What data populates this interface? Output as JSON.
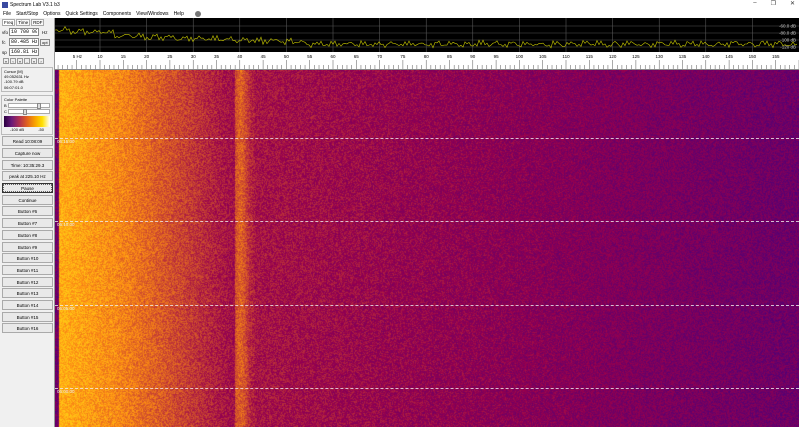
{
  "window": {
    "title": "Spectrum Lab V3.1 b3",
    "minimize": "–",
    "restore": "❐",
    "close": "✕"
  },
  "menu": [
    "File",
    "Start/Stop",
    "Options",
    "Quick Settings",
    "Components",
    "View/Windows",
    "Help"
  ],
  "tabs": [
    "Freq",
    "Time",
    "RDF"
  ],
  "freq": {
    "vfo_label": "vfo",
    "vfo": "10 700 000",
    "vfo_unit": "Hz",
    "fc_label": "fc",
    "fc": "80.485 Hz",
    "opt": "opt",
    "sp_label": "sp",
    "sp": "160.81 Hz"
  },
  "nav_arrows": [
    "«",
    "‹",
    "«",
    "-",
    "»",
    "›"
  ],
  "cursor": {
    "title": "Cursor [M]",
    "freq": "49.052631 Hz",
    "level": "-100.79 dB",
    "time": "06:07:01.0"
  },
  "palette": {
    "title": "Color Palette",
    "b": "B",
    "c": "C",
    "min": "-100 dB",
    "max": "-50"
  },
  "buttons": [
    "Read 10:08:09",
    "Capture now",
    "Time:  10:35:29.3",
    "peak at 225.10 Hz",
    "Pause",
    "Continue",
    "Button #6",
    "Button #7",
    "Button #8",
    "Button #9",
    "Button #10",
    "Button #11",
    "Button #12",
    "Button #13",
    "Button #14",
    "Button #15",
    "Button #16"
  ],
  "spectrum": {
    "db_labels": [
      "-60.0 dB",
      "-80.0 dB",
      "-100 dB",
      "-120 dB"
    ],
    "trace_color": "#c8c800"
  },
  "axis": {
    "first_label": "5  Hz",
    "ticks": [
      10,
      15,
      20,
      25,
      30,
      35,
      40,
      45,
      50,
      55,
      60,
      65,
      70,
      75,
      80,
      85,
      90,
      95,
      100,
      105,
      110,
      115,
      120,
      125,
      130,
      135,
      140,
      145,
      150,
      155
    ]
  },
  "waterfall": {
    "time_labels": [
      "06:15:00",
      "06:10:00",
      "06:05:00",
      "06:00:00"
    ]
  }
}
